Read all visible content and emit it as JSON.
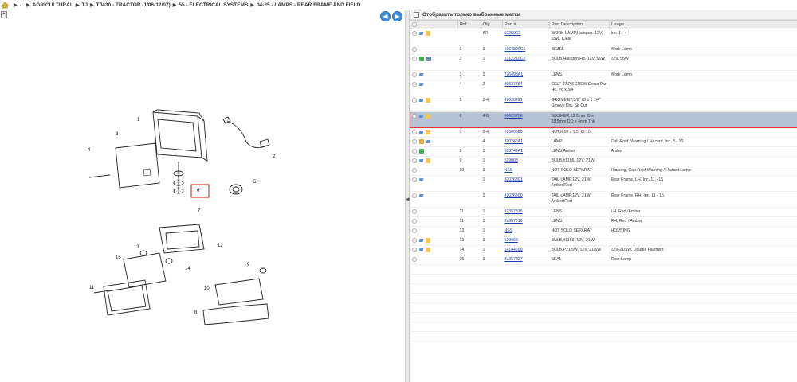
{
  "breadcrumb": {
    "items": [
      "...",
      "AGRICULTURAL",
      "TJ",
      "TJ430 - TRACTOR (1/06-12/07)",
      "55 - ELECTRICAL SYSTEMS",
      "04-25 - LAMPS - REAR FRAME AND FIELD"
    ]
  },
  "filter": {
    "label": "Отобразить только выбранные метки"
  },
  "table": {
    "headers": [
      "Ref",
      "Qty",
      "Part #",
      "Part Description",
      "Usage"
    ],
    "rows": [
      {
        "ref": "",
        "qty": "AR",
        "part": "92269C1",
        "desc": "WORK LAMP,Halogen, 12V, 55W, Clear",
        "usage": "Inc. 1 - 4"
      },
      {
        "ref": "1",
        "qty": "1",
        "part": "1964806C1",
        "desc": "BEZEL",
        "usage": "Work Lamp"
      },
      {
        "ref": "2",
        "qty": "1",
        "part": "1312210C2",
        "desc": "BULB,Halogen H3, 12V, 55W",
        "usage": "12V, 55W"
      },
      {
        "ref": "3",
        "qty": "1",
        "part": "276498A1",
        "desc": "LENS",
        "usage": "Work Lamp"
      },
      {
        "ref": "4",
        "qty": "2",
        "part": "86637784",
        "desc": "SELF-TAP SCREW,Cross Pan Hd, #6 x 3/4\"",
        "usage": ""
      },
      {
        "ref": "5",
        "qty": "2-4",
        "part": "87030421",
        "desc": "GROMMET,3/8\" ID x 1 1/4\" Groove Dia, Slr Cut",
        "usage": ""
      },
      {
        "ref": "6",
        "qty": "4-8",
        "part": "86625256",
        "desc": "WASHER,13.5mm ID x 28.5mm OD x 4mm Thk",
        "usage": ""
      },
      {
        "ref": "7",
        "qty": "2-4",
        "part": "86500689",
        "desc": "NUT,M10 x 1.5, Cl 10",
        "usage": ""
      },
      {
        "ref": "",
        "qty": "4",
        "part": "320246A1",
        "desc": "LAMP",
        "usage": "Cab Roof, Warning / Hazard, Inc. 8 - 10"
      },
      {
        "ref": "8",
        "qty": "1",
        "part": "183749A1",
        "desc": "LENS,Amber",
        "usage": "Amber"
      },
      {
        "ref": "9",
        "qty": "1",
        "part": "529068",
        "desc": "BULB,#1156, 12V, 21W",
        "usage": ""
      },
      {
        "ref": "10",
        "qty": "1",
        "part": "NSS",
        "desc": "NOT SOLD SEPARAT",
        "usage": "Housing, Cab Roof Warning / Hazard Lamp"
      },
      {
        "ref": "",
        "qty": "1",
        "part": "82026301",
        "desc": "TAIL LAMP,12V, 21W, Amber/Red",
        "usage": "Rear Frame, LH, Inc. 11 - 15"
      },
      {
        "ref": "",
        "qty": "1",
        "part": "82026300",
        "desc": "TAIL LAMP,12V, 21W, Amber/Red",
        "usage": "Rear Frame, RH, Inc. 11 - 15"
      },
      {
        "ref": "11",
        "qty": "1",
        "part": "87357815",
        "desc": "LENS",
        "usage": "LH, Red /Amber"
      },
      {
        "ref": "11",
        "qty": "1",
        "part": "87357816",
        "desc": "LENS",
        "usage": "RH, Red / Amber"
      },
      {
        "ref": "12",
        "qty": "1",
        "part": "NSS",
        "desc": "NOT SOLD SEPARAT",
        "usage": "HOUSING"
      },
      {
        "ref": "13",
        "qty": "1",
        "part": "529068",
        "desc": "BULB,#1156, 12V, 21W",
        "usage": ""
      },
      {
        "ref": "14",
        "qty": "1",
        "part": "14144699",
        "desc": "BULB,P21/5W, 12V, 21/5W",
        "usage": "12V-21/5W, Double Filament"
      },
      {
        "ref": "15",
        "qty": "1",
        "part": "87357827",
        "desc": "SEAL",
        "usage": "Rear Lamp"
      }
    ]
  },
  "drawing": {
    "callouts": [
      "1",
      "2",
      "3",
      "4",
      "5",
      "6",
      "7",
      "8",
      "9",
      "10",
      "11",
      "12",
      "13",
      "14",
      "15"
    ]
  },
  "colors": {
    "selected_row": "#b5c3d5",
    "highlight_border": "#dd3333",
    "link": "#1a3da8",
    "nav_button": "#3e8fdb"
  }
}
